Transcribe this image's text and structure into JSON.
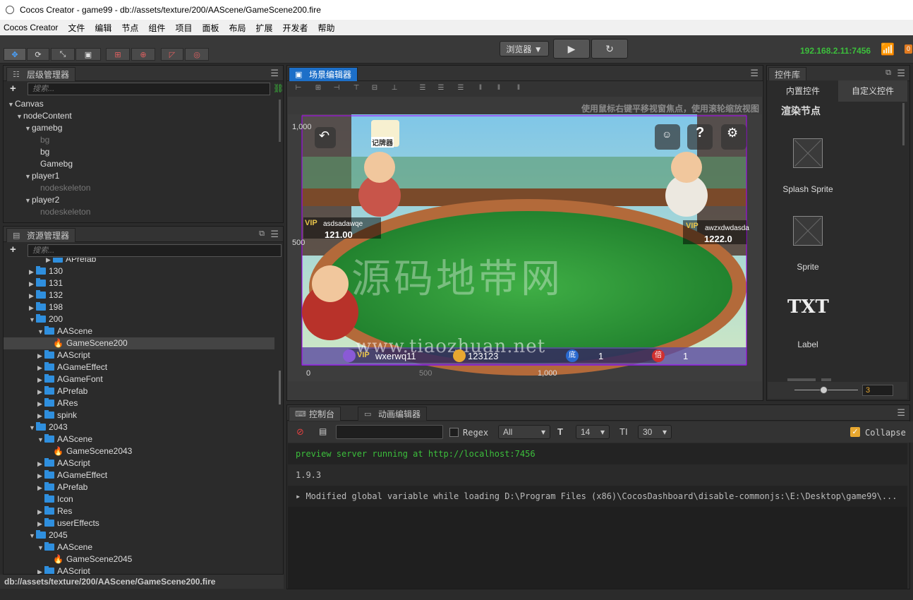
{
  "window": {
    "title": "Cocos Creator - game99 - db://assets/texture/200/AAScene/GameScene200.fire"
  },
  "menu": [
    "Cocos Creator",
    "文件",
    "编辑",
    "节点",
    "组件",
    "项目",
    "面板",
    "布局",
    "扩展",
    "开发者",
    "帮助"
  ],
  "toolbar": {
    "browser_select": "浏览器 ▼",
    "play": "▶",
    "refresh": "↻",
    "ip": "192.168.2.11:7456",
    "notif_count": "0"
  },
  "hierarchy": {
    "title": "层级管理器",
    "search_placeholder": "搜索...",
    "nodes": [
      {
        "label": "Canvas",
        "depth": 0,
        "arrow": "▼",
        "dim": false
      },
      {
        "label": "nodeContent",
        "depth": 1,
        "arrow": "▼",
        "dim": false
      },
      {
        "label": "gamebg",
        "depth": 2,
        "arrow": "▼",
        "dim": false
      },
      {
        "label": "bg",
        "depth": 3,
        "arrow": "",
        "dim": true
      },
      {
        "label": "bg",
        "depth": 3,
        "arrow": "",
        "dim": false
      },
      {
        "label": "Gamebg",
        "depth": 3,
        "arrow": "",
        "dim": false
      },
      {
        "label": "player1",
        "depth": 2,
        "arrow": "▼",
        "dim": false
      },
      {
        "label": "nodeskeleton",
        "depth": 3,
        "arrow": "",
        "dim": true
      },
      {
        "label": "player2",
        "depth": 2,
        "arrow": "▼",
        "dim": false
      },
      {
        "label": "nodeskeleton",
        "depth": 3,
        "arrow": "",
        "dim": true
      }
    ]
  },
  "assets": {
    "title": "资源管理器",
    "search_placeholder": "搜索...",
    "items": [
      {
        "label": "APrefab",
        "depth": 4,
        "type": "folder",
        "arrow": "▶"
      },
      {
        "label": "130",
        "depth": 2,
        "type": "folder",
        "arrow": "▶"
      },
      {
        "label": "131",
        "depth": 2,
        "type": "folder",
        "arrow": "▶"
      },
      {
        "label": "132",
        "depth": 2,
        "type": "folder",
        "arrow": "▶"
      },
      {
        "label": "198",
        "depth": 2,
        "type": "folder",
        "arrow": "▶"
      },
      {
        "label": "200",
        "depth": 2,
        "type": "folder",
        "arrow": "▼"
      },
      {
        "label": "AAScene",
        "depth": 3,
        "type": "folder",
        "arrow": "▼"
      },
      {
        "label": "GameScene200",
        "depth": 4,
        "type": "scene",
        "arrow": "",
        "selected": true
      },
      {
        "label": "AAScript",
        "depth": 3,
        "type": "folder",
        "arrow": "▶"
      },
      {
        "label": "AGameEffect",
        "depth": 3,
        "type": "folder",
        "arrow": "▶"
      },
      {
        "label": "AGameFont",
        "depth": 3,
        "type": "folder",
        "arrow": "▶"
      },
      {
        "label": "APrefab",
        "depth": 3,
        "type": "folder",
        "arrow": "▶"
      },
      {
        "label": "ARes",
        "depth": 3,
        "type": "folder",
        "arrow": "▶"
      },
      {
        "label": "spink",
        "depth": 3,
        "type": "folder",
        "arrow": "▶"
      },
      {
        "label": "2043",
        "depth": 2,
        "type": "folder",
        "arrow": "▼"
      },
      {
        "label": "AAScene",
        "depth": 3,
        "type": "folder",
        "arrow": "▼"
      },
      {
        "label": "GameScene2043",
        "depth": 4,
        "type": "scene",
        "arrow": ""
      },
      {
        "label": "AAScript",
        "depth": 3,
        "type": "folder",
        "arrow": "▶"
      },
      {
        "label": "AGameEffect",
        "depth": 3,
        "type": "folder",
        "arrow": "▶"
      },
      {
        "label": "APrefab",
        "depth": 3,
        "type": "folder",
        "arrow": "▶"
      },
      {
        "label": "Icon",
        "depth": 3,
        "type": "folder",
        "arrow": ""
      },
      {
        "label": "Res",
        "depth": 3,
        "type": "folder",
        "arrow": "▶"
      },
      {
        "label": "userEffects",
        "depth": 3,
        "type": "folder",
        "arrow": "▶"
      },
      {
        "label": "2045",
        "depth": 2,
        "type": "folder",
        "arrow": "▼"
      },
      {
        "label": "AAScene",
        "depth": 3,
        "type": "folder",
        "arrow": "▼"
      },
      {
        "label": "GameScene2045",
        "depth": 4,
        "type": "scene",
        "arrow": ""
      },
      {
        "label": "AAScript",
        "depth": 3,
        "type": "folder",
        "arrow": "▶"
      }
    ],
    "status_path": "db://assets/texture/200/AAScene/GameScene200.fire"
  },
  "scene_editor": {
    "title": "场景编辑器",
    "hint": "使用鼠标右键平移视窗焦点，使用滚轮缩放视图",
    "ruler": {
      "y_top": "1,000",
      "y_mid": "500",
      "x_zero": "0",
      "x_mid": "500",
      "x_right": "1,000"
    },
    "game": {
      "record_label": "记牌器",
      "player_left": {
        "name": "asdsadawqe",
        "coins": "121.00"
      },
      "player_right": {
        "name": "awzxdwdasda",
        "coins": "1222.0"
      },
      "self": {
        "name": "wxerwq11",
        "coins": "123123",
        "base_label": "底",
        "base_value": "1",
        "mult_label": "倍",
        "mult_value": "1"
      },
      "watermark_cn": "源码地带网",
      "watermark_url": "www.tiaozhuan.net",
      "vip": "VIP"
    }
  },
  "library": {
    "title": "控件库",
    "tabs": [
      "内置控件",
      "自定义控件"
    ],
    "section": "渲染节点",
    "items": [
      "Splash Sprite",
      "Sprite",
      "Label"
    ],
    "txt_icon": "TXT",
    "zoom_value": "3"
  },
  "console": {
    "tabs": [
      "控制台",
      "动画编辑器"
    ],
    "regex_label": "Regex",
    "filter_select": "All",
    "font_size": "14",
    "line_height": "30",
    "collapse_label": "Collapse",
    "lines": [
      {
        "text": "preview server running at http://localhost:7456",
        "color": "#3cbf3c"
      },
      {
        "text": "1.9.3",
        "color": "#bbbbbb"
      },
      {
        "text": "▸ Modified global variable while loading D:\\Program Files (x86)\\CocosDashboard\\disable-commonjs:\\E:\\Desktop\\game99\\...",
        "color": "#bbbbbb"
      }
    ]
  },
  "colors": {
    "accent_blue": "#1d6fc8",
    "ip_green": "#3cbf3c",
    "table_green": "#2f9a3a",
    "felt_rim": "#c98a55"
  }
}
